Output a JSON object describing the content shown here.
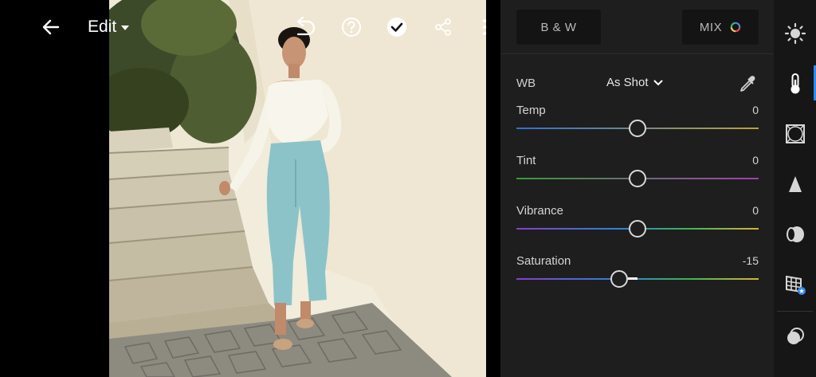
{
  "toolbar": {
    "edit_label": "Edit",
    "icons": [
      "back-arrow-icon",
      "caret-down-icon",
      "undo-icon",
      "help-icon",
      "done-check-icon",
      "share-icon",
      "more-vert-icon"
    ]
  },
  "panel": {
    "bw_label": "B & W",
    "mix_label": "MIX",
    "wb_label": "WB",
    "wb_value": "As Shot",
    "sliders": [
      {
        "label": "Temp",
        "value": "0",
        "level": 0
      },
      {
        "label": "Tint",
        "value": "0",
        "level": 0
      },
      {
        "label": "Vibrance",
        "value": "0",
        "level": 0
      },
      {
        "label": "Saturation",
        "value": "-15",
        "level": -15
      }
    ]
  },
  "rail": {
    "tools": [
      "light-icon",
      "color-icon",
      "effects-icon",
      "detail-icon",
      "optics-icon",
      "geometry-icon",
      "presets-icon"
    ],
    "active_tool": "color-icon"
  },
  "colors": {
    "accent": "#2b8cf0",
    "panel_bg": "#1e1e1e",
    "rail_bg": "#161616"
  }
}
